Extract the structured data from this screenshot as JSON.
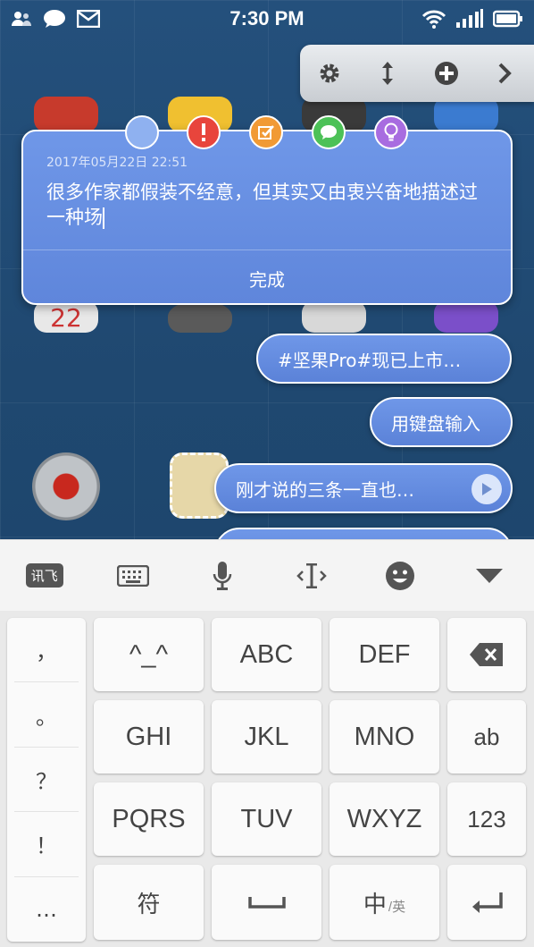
{
  "status_bar": {
    "time": "7:30 PM"
  },
  "note": {
    "date": "2017年05月22日 22:51",
    "content": "很多作家都假装不经意，但其实又由衷兴奋地描述过一种场",
    "done_label": "完成"
  },
  "note_colors": [
    "#8fb1f0",
    "#e8453c",
    "#f19a35",
    "#4cc157",
    "#a86ce0"
  ],
  "bubbles": [
    {
      "text": "#坚果Pro#现已上市…"
    },
    {
      "text": "用键盘输入"
    },
    {
      "text": "刚才说的三条一直也…"
    }
  ],
  "keyboard": {
    "bar": {
      "xunfei_label": "讯飞"
    },
    "punctuation": [
      "，",
      "。",
      "？",
      "！",
      "…"
    ],
    "keys": {
      "face": "^_^",
      "abc": "ABC",
      "def": "DEF",
      "ghi": "GHI",
      "jkl": "JKL",
      "mno": "MNO",
      "ab": "ab",
      "pqrs": "PQRS",
      "tuv": "TUV",
      "wxyz": "WXYZ",
      "num": "123",
      "symbol": "符",
      "lang_main": "中",
      "lang_sub": "/英"
    }
  }
}
